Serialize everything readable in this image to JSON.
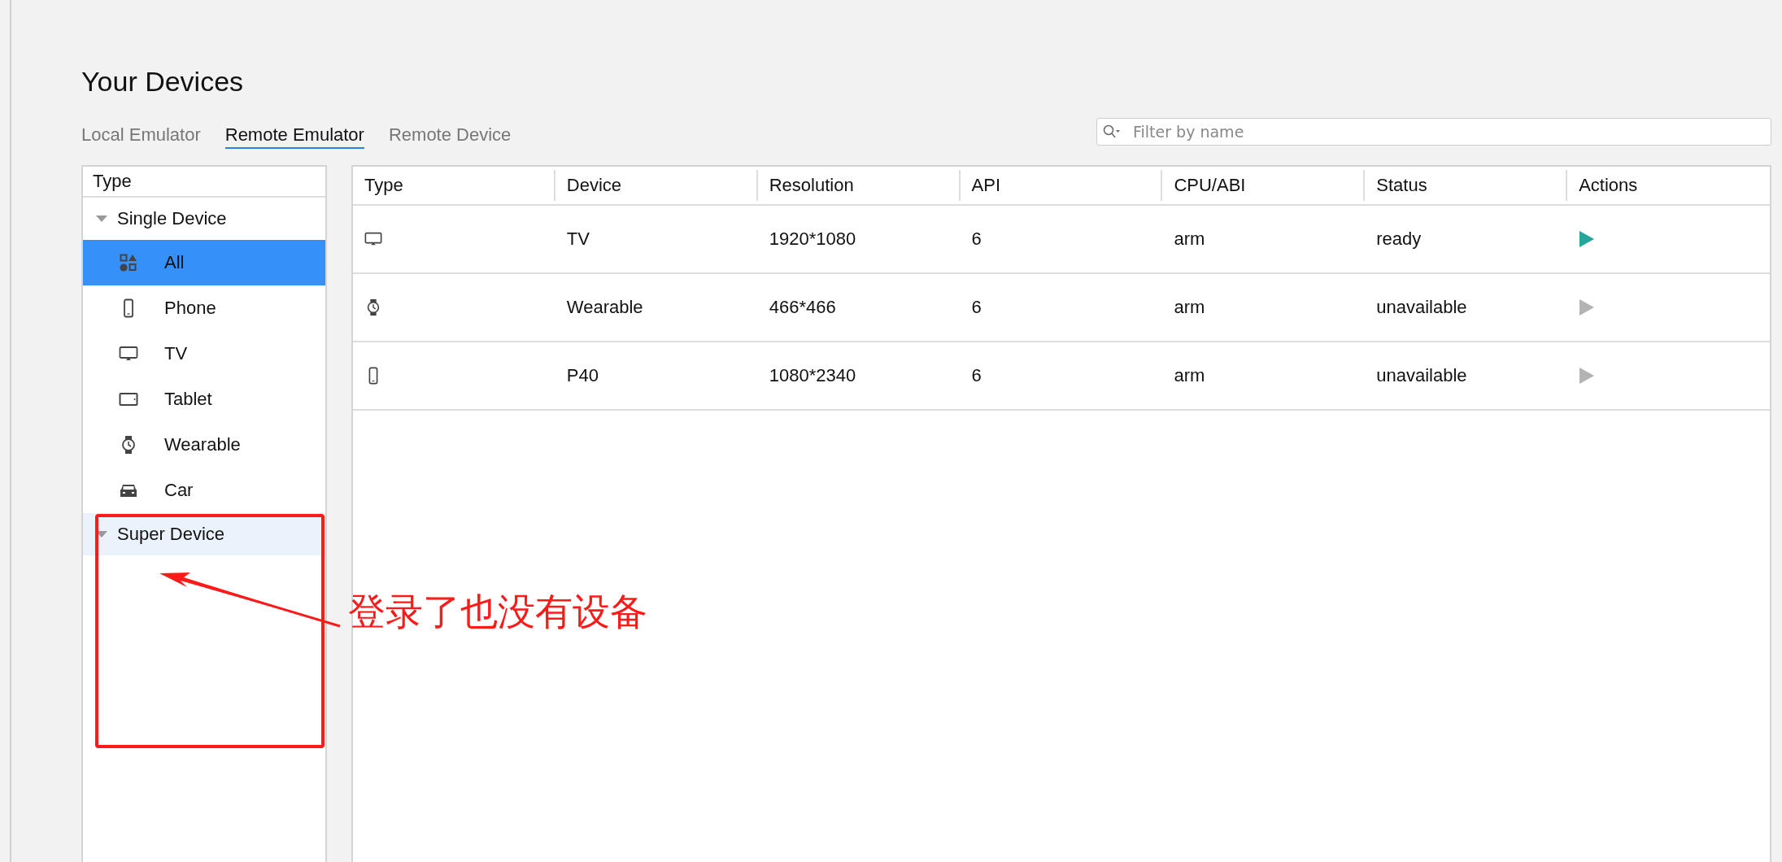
{
  "title": "Your Devices",
  "tabs": [
    {
      "label": "Local Emulator",
      "selected": false
    },
    {
      "label": "Remote Emulator",
      "selected": true
    },
    {
      "label": "Remote Device",
      "selected": false
    }
  ],
  "search": {
    "placeholder": "Filter by name"
  },
  "sidebar": {
    "header": "Type",
    "groups": [
      {
        "label": "Single Device",
        "expanded": true,
        "highlighted": false,
        "items": [
          {
            "label": "All",
            "kind": "all",
            "selected": true
          },
          {
            "label": "Phone",
            "kind": "phone",
            "selected": false
          },
          {
            "label": "TV",
            "kind": "tv",
            "selected": false
          },
          {
            "label": "Tablet",
            "kind": "tablet",
            "selected": false
          },
          {
            "label": "Wearable",
            "kind": "wearable",
            "selected": false
          },
          {
            "label": "Car",
            "kind": "car",
            "selected": false
          }
        ]
      },
      {
        "label": "Super Device",
        "expanded": true,
        "highlighted": true
      }
    ]
  },
  "table": {
    "columns": [
      "Type",
      "Device",
      "Resolution",
      "API",
      "CPU/ABI",
      "Status",
      "Actions"
    ],
    "rows": [
      {
        "kind": "tv",
        "device": "TV",
        "resolution": "1920*1080",
        "api": "6",
        "cpu": "arm",
        "status": "ready",
        "enabled": true
      },
      {
        "kind": "wearable",
        "device": "Wearable",
        "resolution": "466*466",
        "api": "6",
        "cpu": "arm",
        "status": "unavailable",
        "enabled": false
      },
      {
        "kind": "phone",
        "device": "P40",
        "resolution": "1080*2340",
        "api": "6",
        "cpu": "arm",
        "status": "unavailable",
        "enabled": false
      }
    ]
  },
  "annotation": {
    "text": "登录了也没有设备"
  }
}
